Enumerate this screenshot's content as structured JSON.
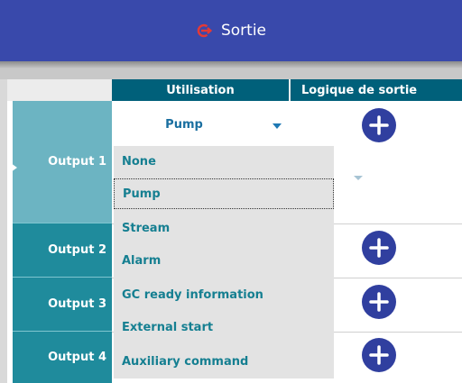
{
  "titlebar": {
    "title": "Sortie",
    "icon": "power-arrow-icon"
  },
  "table": {
    "columns": [
      "Utilisation",
      "Logique de sortie"
    ],
    "rows": [
      {
        "label": "Output 1",
        "selected": true
      },
      {
        "label": "Output 2"
      },
      {
        "label": "Output 3"
      },
      {
        "label": "Output 4"
      }
    ],
    "current_value": "Pump"
  },
  "dropdown": {
    "options": [
      "None",
      "Pump",
      "Stream",
      "Alarm",
      "GC ready information",
      "External start",
      "Auxiliary command"
    ],
    "focused_option": "Pump"
  },
  "colors": {
    "titlebar": "#3949ab",
    "header": "#00607a",
    "row": "#1f8b9c",
    "row_selected": "#6cb4c2",
    "plus_button": "#303f9f",
    "dropdown_text": "#157f91",
    "icon": "#e53935"
  }
}
